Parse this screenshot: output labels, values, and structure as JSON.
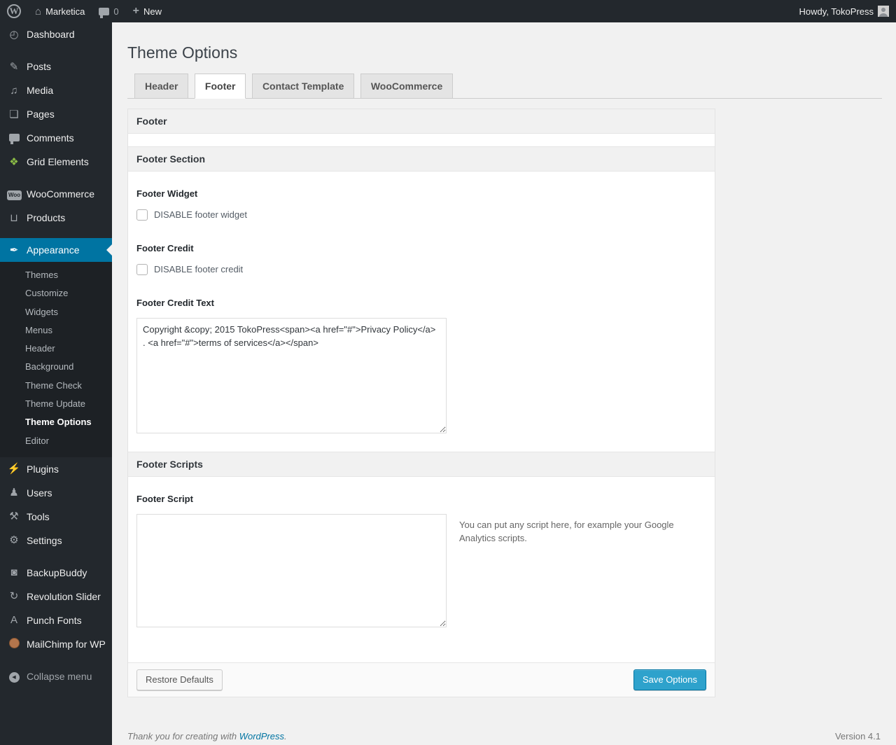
{
  "admin_bar": {
    "wp_logo": "W",
    "site_name": "Marketica",
    "comment_count": "0",
    "plus": "+",
    "new_label": "New",
    "howdy": "Howdy, TokoPress"
  },
  "sidebar": {
    "items": [
      {
        "glyph": "◴",
        "label": "Dashboard"
      },
      {
        "glyph": "✎",
        "label": "Posts"
      },
      {
        "glyph": "♫",
        "label": "Media"
      },
      {
        "glyph": "❏",
        "label": "Pages"
      },
      {
        "glyph": "",
        "label": "Comments"
      },
      {
        "glyph": "❖",
        "label": "Grid Elements"
      },
      {
        "glyph": "Woo",
        "label": "WooCommerce"
      },
      {
        "glyph": "⊔",
        "label": "Products"
      },
      {
        "glyph": "✒",
        "label": "Appearance"
      },
      {
        "glyph": "⚡",
        "label": "Plugins"
      },
      {
        "glyph": "♟",
        "label": "Users"
      },
      {
        "glyph": "⚒",
        "label": "Tools"
      },
      {
        "glyph": "⚙",
        "label": "Settings"
      },
      {
        "glyph": "◙",
        "label": "BackupBuddy"
      },
      {
        "glyph": "↻",
        "label": "Revolution Slider"
      },
      {
        "glyph": "A",
        "label": "Punch Fonts"
      },
      {
        "glyph": "",
        "label": "MailChimp for WP"
      }
    ],
    "appearance_submenu": [
      {
        "label": "Themes"
      },
      {
        "label": "Customize"
      },
      {
        "label": "Widgets"
      },
      {
        "label": "Menus"
      },
      {
        "label": "Header"
      },
      {
        "label": "Background"
      },
      {
        "label": "Theme Check"
      },
      {
        "label": "Theme Update"
      },
      {
        "label": "Theme Options"
      },
      {
        "label": "Editor"
      }
    ],
    "collapse": {
      "glyph": "◀",
      "label": "Collapse menu"
    }
  },
  "main": {
    "page_title": "Theme Options",
    "tabs": [
      {
        "label": "Header"
      },
      {
        "label": "Footer"
      },
      {
        "label": "Contact Template"
      },
      {
        "label": "WooCommerce"
      }
    ],
    "panel": {
      "section_footer_title": "Footer",
      "section_footer_section_title": "Footer Section",
      "footer_widget_label": "Footer Widget",
      "footer_widget_checkbox_label": "DISABLE footer widget",
      "footer_credit_label": "Footer Credit",
      "footer_credit_checkbox_label": "DISABLE footer credit",
      "footer_credit_text_label": "Footer Credit Text",
      "footer_credit_text_value": "Copyright &copy; 2015 TokoPress<span><a href=\"#\">Privacy Policy</a> . <a href=\"#\">terms of services</a></span>",
      "section_footer_scripts_title": "Footer Scripts",
      "footer_script_label": "Footer Script",
      "footer_script_value": "",
      "footer_script_help": "You can put any script here, for example your Google Analytics scripts.",
      "restore_button": "Restore Defaults",
      "save_button": "Save Options"
    },
    "footer": {
      "thanks_prefix": "Thank you for creating with ",
      "wordpress_link": "WordPress",
      "thanks_suffix": ".",
      "version": "Version 4.1"
    }
  },
  "colors": {
    "accent": "#0074a2",
    "primary_button": "#2ea2cc",
    "menu_bg": "#23282d",
    "submenu_bg": "#1d2125",
    "page_bg": "#f1f1f1",
    "panel_header_bg": "#f1f1f1"
  }
}
